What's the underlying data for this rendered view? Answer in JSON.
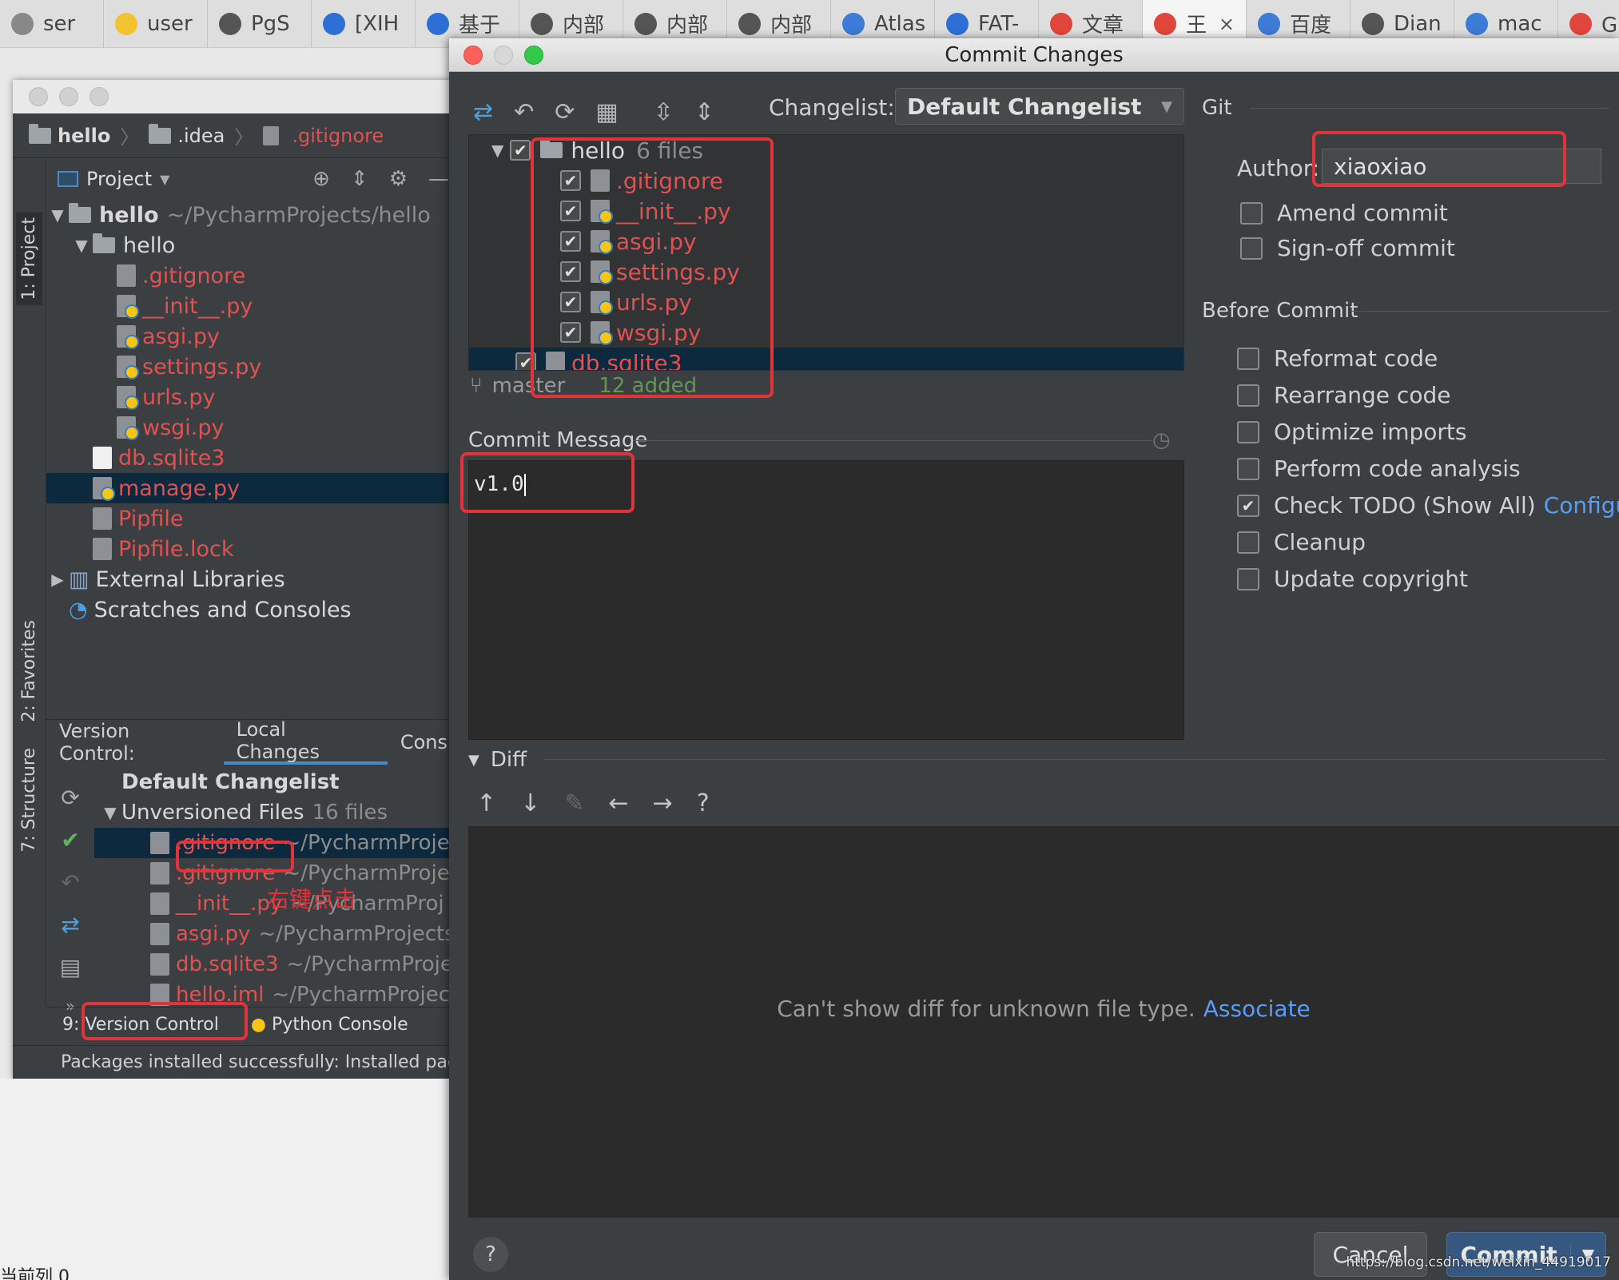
{
  "browser_tabs": [
    {
      "label": "ser",
      "icon_color": "#888888"
    },
    {
      "label": "user",
      "icon_color": "#f2c230"
    },
    {
      "label": "PgS",
      "icon_color": "#555555"
    },
    {
      "label": "[XIH",
      "icon_color": "#2e6fd6"
    },
    {
      "label": "基于",
      "icon_color": "#2e6fd6"
    },
    {
      "label": "内部",
      "icon_color": "#555555"
    },
    {
      "label": "内部",
      "icon_color": "#555555"
    },
    {
      "label": "内部",
      "icon_color": "#555555"
    },
    {
      "label": "Atlas",
      "icon_color": "#3c7bd6"
    },
    {
      "label": "FAT-",
      "icon_color": "#2e6fd6"
    },
    {
      "label": "文章",
      "icon_color": "#e0463c"
    },
    {
      "label": "王",
      "icon_color": "#e0463c",
      "active": true
    },
    {
      "label": "百度",
      "icon_color": "#3c7bd6"
    },
    {
      "label": "Dian",
      "icon_color": "#555555"
    },
    {
      "label": "mac",
      "icon_color": "#3c7bd6"
    },
    {
      "label": "Git安",
      "icon_color": "#e0463c"
    }
  ],
  "ide": {
    "breadcrumb": [
      "hello",
      ".idea",
      ".gitignore"
    ],
    "side_tabs": {
      "project": "1: Project",
      "favorites": "2: Favorites",
      "structure": "7: Structure"
    },
    "project_header": "Project",
    "tree": [
      {
        "indent": 0,
        "arrow": "▼",
        "icon": "folder",
        "name": "hello",
        "path": "~/PycharmProjects/hello",
        "color": "white",
        "bold": true
      },
      {
        "indent": 1,
        "arrow": "▼",
        "icon": "folder",
        "name": "hello",
        "color": "white"
      },
      {
        "indent": 2,
        "icon": "file",
        "name": ".gitignore",
        "color": "red"
      },
      {
        "indent": 2,
        "icon": "py",
        "name": "__init__.py",
        "color": "red"
      },
      {
        "indent": 2,
        "icon": "py",
        "name": "asgi.py",
        "color": "red"
      },
      {
        "indent": 2,
        "icon": "py",
        "name": "settings.py",
        "color": "red"
      },
      {
        "indent": 2,
        "icon": "py",
        "name": "urls.py",
        "color": "red"
      },
      {
        "indent": 2,
        "icon": "py",
        "name": "wsgi.py",
        "color": "red"
      },
      {
        "indent": 1,
        "icon": "white",
        "name": "db.sqlite3",
        "color": "red"
      },
      {
        "indent": 1,
        "icon": "py",
        "name": "manage.py",
        "color": "red",
        "selected": true
      },
      {
        "indent": 1,
        "icon": "file",
        "name": "Pipfile",
        "color": "red"
      },
      {
        "indent": 1,
        "icon": "file",
        "name": "Pipfile.lock",
        "color": "red"
      },
      {
        "indent": 0,
        "arrow": "▶",
        "icon": "lib",
        "name": "External Libraries",
        "color": "white"
      },
      {
        "indent": 0,
        "icon": "scratch",
        "name": "Scratches and Consoles",
        "color": "white"
      }
    ],
    "vc_tabs": {
      "label": "Version Control:",
      "local": "Local Changes",
      "console": "Cons"
    },
    "vc_list": [
      {
        "indent": 0,
        "name": "Default Changelist",
        "bold": true
      },
      {
        "indent": 0,
        "arrow": "▼",
        "name": "Unversioned Files",
        "count": "16 files"
      },
      {
        "indent": 1,
        "name": ".gitignore",
        "path": "~/PycharmProje",
        "selected": true,
        "red": true
      },
      {
        "indent": 1,
        "name": ".gitignore",
        "path": "~/PycharmProje",
        "red": true
      },
      {
        "indent": 1,
        "name": "__init__.py",
        "path": "~/PycharmProj",
        "red": true
      },
      {
        "indent": 1,
        "name": "asgi.py",
        "path": "~/PycharmProjects",
        "red": true
      },
      {
        "indent": 1,
        "name": "db.sqlite3",
        "path": "~/PycharmProje",
        "red": true
      },
      {
        "indent": 1,
        "name": "hello.iml",
        "path": "~/PycharmProjec",
        "red": true
      }
    ],
    "bottom_tabs": {
      "vc": "9: Version Control",
      "python_console": "Python Console"
    },
    "status": "Packages installed successfully: Installed packages"
  },
  "annotation": "右键点击",
  "below_text": "当前列 0",
  "dialog": {
    "title": "Commit Changes",
    "changelist_label": "Changelist:",
    "changelist_value": "Default Changelist",
    "changes": [
      {
        "indent": 0,
        "arrow": "▼",
        "icon": "folder",
        "name": "hello",
        "count": "6 files",
        "color": "white"
      },
      {
        "indent": 1,
        "icon": "file",
        "name": ".gitignore",
        "color": "red"
      },
      {
        "indent": 1,
        "icon": "py",
        "name": "__init__.py",
        "color": "red"
      },
      {
        "indent": 1,
        "icon": "py",
        "name": "asgi.py",
        "color": "red"
      },
      {
        "indent": 1,
        "icon": "py",
        "name": "settings.py",
        "color": "red"
      },
      {
        "indent": 1,
        "icon": "py",
        "name": "urls.py",
        "color": "red"
      },
      {
        "indent": 1,
        "icon": "py",
        "name": "wsgi.py",
        "color": "red"
      },
      {
        "indent": 0,
        "icon": "db",
        "name": "db.sqlite3",
        "color": "red",
        "selected": true
      }
    ],
    "branch": "master",
    "added": "12 added",
    "commit_message_label": "Commit Message",
    "commit_message": "v1.0",
    "diff_label": "Diff",
    "diff_message": "Can't show diff for unknown file type.",
    "diff_link": "Associate",
    "git": {
      "label": "Git",
      "author_label": "Author:",
      "author_value": "xiaoxiao",
      "amend": "Amend commit",
      "signoff": "Sign-off commit"
    },
    "before_commit": {
      "label": "Before Commit",
      "options": [
        {
          "label": "Reformat code",
          "checked": false
        },
        {
          "label": "Rearrange code",
          "checked": false
        },
        {
          "label": "Optimize imports",
          "checked": false
        },
        {
          "label": "Perform code analysis",
          "checked": false
        },
        {
          "label": "Check TODO (Show All)",
          "checked": true,
          "link": "Configure"
        },
        {
          "label": "Cleanup",
          "checked": false
        },
        {
          "label": "Update copyright",
          "checked": false
        }
      ]
    },
    "cancel": "Cancel",
    "commit": "Commit",
    "watermark": "https://blog.csdn.net/weixin_44919017"
  }
}
